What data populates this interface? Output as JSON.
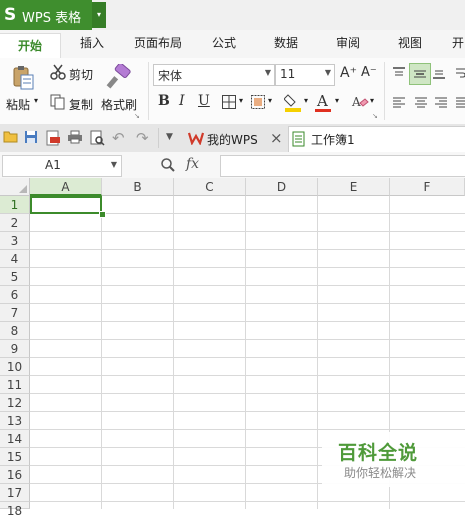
{
  "app": {
    "logo": "S",
    "name": "WPS 表格",
    "dropdown": "▾"
  },
  "tabs": [
    "开始",
    "插入",
    "页面布局",
    "公式",
    "数据",
    "审阅",
    "视图",
    "开"
  ],
  "ribbon": {
    "paste": "粘贴",
    "cut": "剪切",
    "copy": "复制",
    "format_painter": "格式刷",
    "font_name": "宋体",
    "font_size": "11",
    "bold": "B",
    "italic": "I",
    "underline": "U",
    "font_color_letter": "A",
    "grow_font": "A⁺",
    "shrink_font": "A⁻",
    "accent": "#3f8e2e",
    "font_color": "#e03020",
    "fill_color": "#f5d000"
  },
  "doc_tabs": [
    {
      "label": "我的WPS",
      "close": "×"
    },
    {
      "label": "工作簿1"
    }
  ],
  "formula_bar": {
    "cell_ref": "A1",
    "fx": "fx",
    "value": ""
  },
  "sheet": {
    "columns": [
      "A",
      "B",
      "C",
      "D",
      "E",
      "F"
    ],
    "rows": [
      "1",
      "2",
      "3",
      "4",
      "5",
      "6",
      "7",
      "8",
      "9",
      "10",
      "11",
      "12",
      "13",
      "14",
      "15",
      "16",
      "17",
      "18"
    ],
    "selected_cell": "A1"
  },
  "watermark": {
    "title": "百科全说",
    "subtitle": "助你轻松解决"
  }
}
